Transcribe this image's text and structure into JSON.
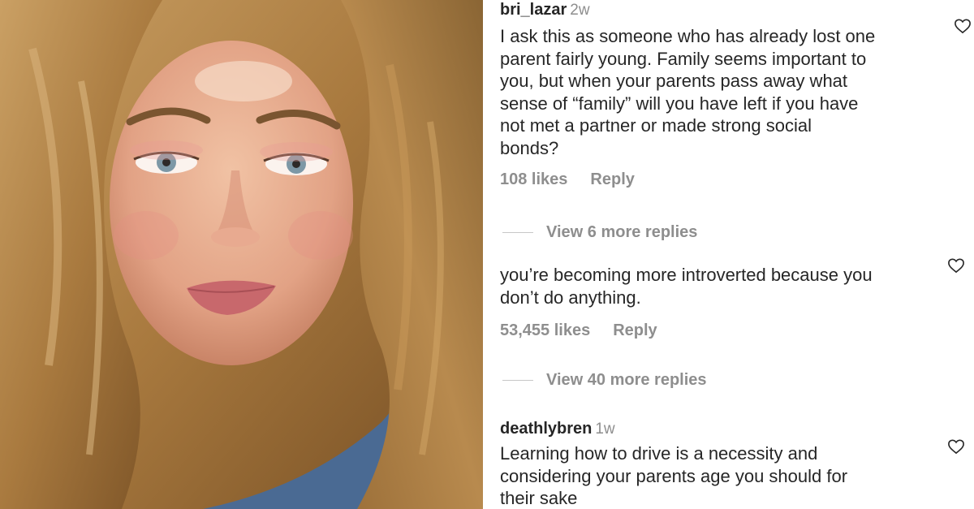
{
  "photo": {
    "alt": "",
    "hair_color": "#b8894e",
    "bg_color": "#4a4a4c"
  },
  "comments": [
    {
      "username": "bri_lazar",
      "time": "2w",
      "lines": [
        "I ask this as someone who has already lost one",
        "parent fairly young. Family seems important to",
        "you, but when your parents pass away what",
        "sense of “family” will you have left if you have",
        "not met a partner or made strong social",
        "bonds?"
      ],
      "likes": "108 likes",
      "reply": "Reply",
      "view_replies": "View 6 more replies"
    },
    {
      "username": "",
      "time": "",
      "lines": [
        "you’re becoming more introverted because you",
        "don’t do anything."
      ],
      "likes": "53,455 likes",
      "reply": "Reply",
      "view_replies": "View 40 more replies"
    },
    {
      "username": "deathlybren",
      "time": "1w",
      "lines": [
        "Learning how to drive is a necessity and",
        "considering your parents age you should for",
        "their sake"
      ]
    }
  ],
  "colors": {
    "text": "#262626",
    "secondary": "#8e8e8e",
    "divider": "#c7c7c7"
  }
}
